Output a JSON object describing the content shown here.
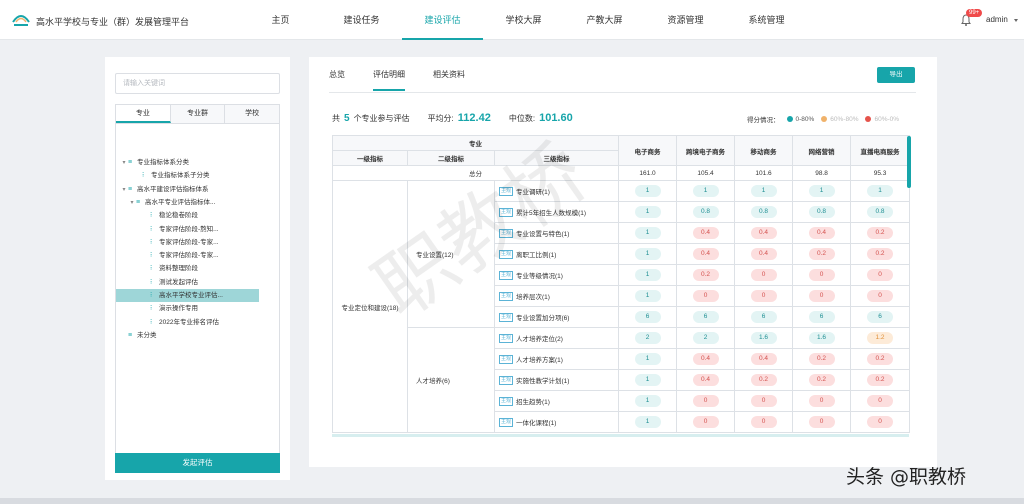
{
  "app": {
    "brand": "高水平学校与专业（群）发展管理平台"
  },
  "nav": {
    "items": [
      "主页",
      "建设任务",
      "建设评估",
      "学校大屏",
      "产教大屏",
      "资源管理",
      "系统管理"
    ],
    "active_index": 2
  },
  "user": {
    "name": "admin",
    "badge": "99+"
  },
  "left": {
    "search_placeholder": "请输入关键词",
    "tabs": [
      "专业",
      "专业群",
      "学校"
    ],
    "active_tab": 0,
    "tree": [
      "专业指标体系分类",
      "专业指标体系子分类",
      "高水平建设评估指标体系",
      "高水平专业评估指标体...",
      "稳论稳卷阶段",
      "专家评估阶段-熬知...",
      "专家评估阶段-专家...",
      "专家评估阶段-专家...",
      "资料整理阶段",
      "测试发起评估",
      "高水平学校专业评估...",
      "演示操作专用",
      "2022年专业排名评估",
      "未分类"
    ],
    "selected_tree_index": 10,
    "start_button": "发起评估"
  },
  "main": {
    "tabs": [
      "总览",
      "评估明细",
      "相关资料"
    ],
    "active_tab": 1,
    "export_button": "导出",
    "summary": {
      "prefix": "共",
      "count": "5",
      "suffix": "个专业参与评估",
      "avg_label": "平均分:",
      "avg_value": "112.42",
      "median_label": "中位数:",
      "median_value": "101.60"
    },
    "legend": {
      "label": "得分情况：",
      "items": [
        {
          "text": "0-80%",
          "color": "#17a5aa"
        },
        {
          "text": "60%-80%",
          "color": "#f0b26a"
        },
        {
          "text": "60%-0%",
          "color": "#e5534b"
        }
      ]
    },
    "table": {
      "major_header": "专业",
      "level1_header": "一级指标",
      "level2_header": "二级指标",
      "level3_header": "三级指标",
      "majors": [
        "电子商务",
        "跨境电子商务",
        "移动商务",
        "网络营销",
        "直播电商服务"
      ],
      "total_label": "总分",
      "totals": [
        "161.0",
        "105.4",
        "101.6",
        "98.8",
        "95.3"
      ],
      "level1_name": "专业定位和建设(18)",
      "level2_groups": [
        "专业设置(12)",
        "人才培养(6)"
      ],
      "tag": "主观",
      "rows": [
        {
          "name": "专业调研(1)",
          "cells": [
            [
              "1",
              "g"
            ],
            [
              "1",
              "g"
            ],
            [
              "1",
              "g"
            ],
            [
              "1",
              "g"
            ],
            [
              "1",
              "g"
            ]
          ]
        },
        {
          "name": "累计5年招生人数规模(1)",
          "cells": [
            [
              "1",
              "g"
            ],
            [
              "0.8",
              "g"
            ],
            [
              "0.8",
              "g"
            ],
            [
              "0.8",
              "g"
            ],
            [
              "0.8",
              "g"
            ]
          ]
        },
        {
          "name": "专业设置与特色(1)",
          "cells": [
            [
              "1",
              "g"
            ],
            [
              "0.4",
              "r"
            ],
            [
              "0.4",
              "r"
            ],
            [
              "0.4",
              "r"
            ],
            [
              "0.2",
              "r"
            ]
          ]
        },
        {
          "name": "离职工比例(1)",
          "cells": [
            [
              "1",
              "g"
            ],
            [
              "0.4",
              "r"
            ],
            [
              "0.4",
              "r"
            ],
            [
              "0.2",
              "r"
            ],
            [
              "0.2",
              "r"
            ]
          ]
        },
        {
          "name": "专业等级情况(1)",
          "cells": [
            [
              "1",
              "g"
            ],
            [
              "0.2",
              "r"
            ],
            [
              "0",
              "r"
            ],
            [
              "0",
              "r"
            ],
            [
              "0",
              "r"
            ]
          ]
        },
        {
          "name": "培养层次(1)",
          "cells": [
            [
              "1",
              "g"
            ],
            [
              "0",
              "r"
            ],
            [
              "0",
              "r"
            ],
            [
              "0",
              "r"
            ],
            [
              "0",
              "r"
            ]
          ]
        },
        {
          "name": "专业设置加分项(6)",
          "cells": [
            [
              "6",
              "g"
            ],
            [
              "6",
              "g"
            ],
            [
              "6",
              "g"
            ],
            [
              "6",
              "g"
            ],
            [
              "6",
              "g"
            ]
          ]
        },
        {
          "name": "人才培养定位(2)",
          "cells": [
            [
              "2",
              "g"
            ],
            [
              "2",
              "g"
            ],
            [
              "1.6",
              "g"
            ],
            [
              "1.6",
              "g"
            ],
            [
              "1.2",
              "o"
            ]
          ]
        },
        {
          "name": "人才培养方案(1)",
          "cells": [
            [
              "1",
              "g"
            ],
            [
              "0.4",
              "r"
            ],
            [
              "0.4",
              "r"
            ],
            [
              "0.2",
              "r"
            ],
            [
              "0.2",
              "r"
            ]
          ]
        },
        {
          "name": "实施性教学计划(1)",
          "cells": [
            [
              "1",
              "g"
            ],
            [
              "0.4",
              "r"
            ],
            [
              "0.2",
              "r"
            ],
            [
              "0.2",
              "r"
            ],
            [
              "0.2",
              "r"
            ]
          ]
        },
        {
          "name": "招生趋势(1)",
          "cells": [
            [
              "1",
              "g"
            ],
            [
              "0",
              "r"
            ],
            [
              "0",
              "r"
            ],
            [
              "0",
              "r"
            ],
            [
              "0",
              "r"
            ]
          ]
        },
        {
          "name": "一体化课程(1)",
          "cells": [
            [
              "1",
              "g"
            ],
            [
              "0",
              "r"
            ],
            [
              "0",
              "r"
            ],
            [
              "0",
              "r"
            ],
            [
              "0",
              "r"
            ]
          ]
        }
      ]
    }
  },
  "watermark": "职教桥",
  "corner_mark": "头条 @职教桥",
  "colors": {
    "accent": "#17a5aa",
    "bad": "#d4524f",
    "warn": "#e0913a"
  }
}
